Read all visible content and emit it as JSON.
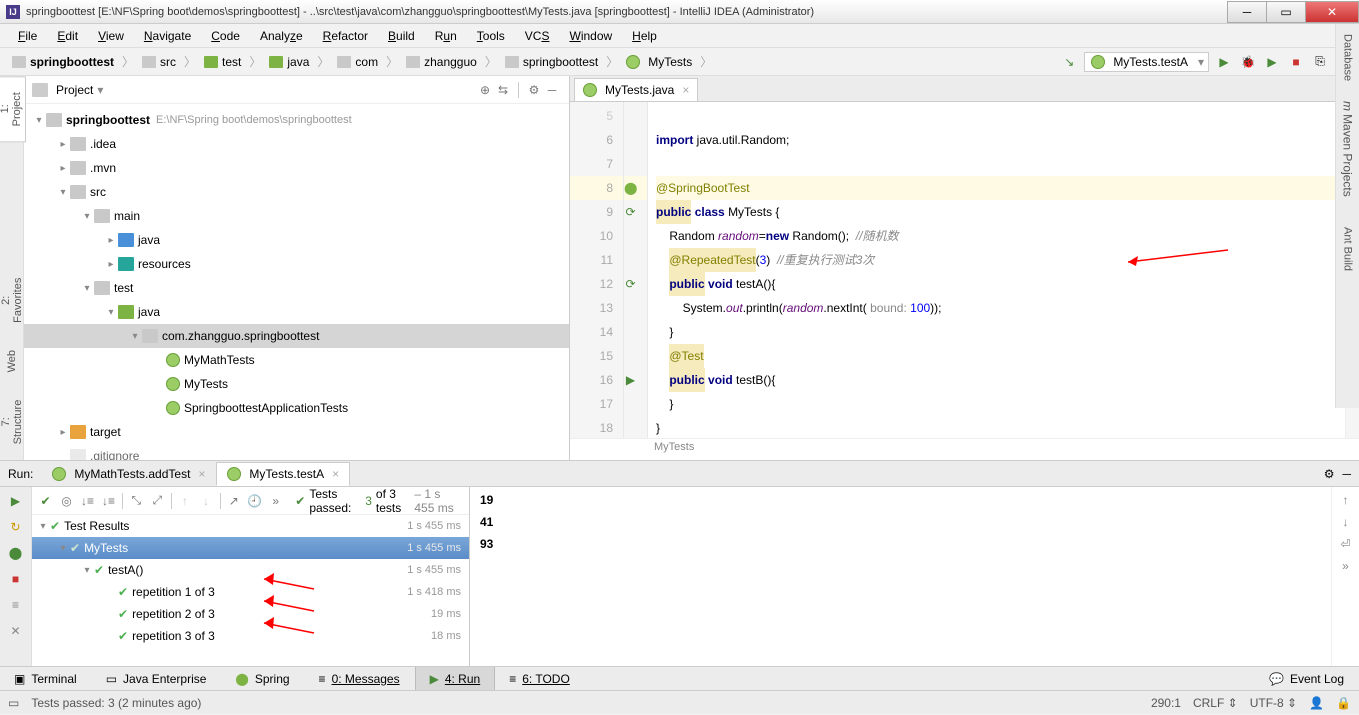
{
  "titlebar": {
    "text": "springboottest [E:\\NF\\Spring boot\\demos\\springboottest] - ..\\src\\test\\java\\com\\zhangguo\\springboottest\\MyTests.java [springboottest] - IntelliJ IDEA (Administrator)"
  },
  "menu": [
    "File",
    "Edit",
    "View",
    "Navigate",
    "Code",
    "Analyze",
    "Refactor",
    "Build",
    "Run",
    "Tools",
    "VCS",
    "Window",
    "Help"
  ],
  "breadcrumbs": [
    "springboottest",
    "src",
    "test",
    "java",
    "com",
    "zhangguo",
    "springboottest",
    "MyTests"
  ],
  "run_config": "MyTests.testA",
  "project_panel_title": "Project",
  "tree": {
    "root": "springboottest",
    "root_path": "E:\\NF\\Spring boot\\demos\\springboottest",
    "idea": ".idea",
    "mvn": ".mvn",
    "src": "src",
    "main": "main",
    "java_m": "java",
    "res": "resources",
    "test": "test",
    "java_t": "java",
    "pkg": "com.zhangguo.springboottest",
    "c1": "MyMathTests",
    "c2": "MyTests",
    "c3": "SpringboottestApplicationTests",
    "target": "target",
    "gitignore": ".gitignore"
  },
  "editor_tab": "MyTests.java",
  "code": {
    "l6": "import java.util.Random;",
    "l8_ann": "@SpringBootTest",
    "l9_a": "public",
    "l9_b": "class",
    "l9_c": "MyTests {",
    "l10_a": "Random ",
    "l10_b": "random",
    "l10_c": "=",
    "l10_d": "new",
    "l10_e": " Random();  ",
    "l10_f": "//随机数",
    "l11_a": "@RepeatedTest",
    "l11_b": "(",
    "l11_c": "3",
    "l11_d": ")  ",
    "l11_e": "//重复执行测试3次",
    "l12_a": "public",
    "l12_b": " ",
    "l12_c": "void",
    "l12_d": " testA(){",
    "l13_a": "System.",
    "l13_b": "out",
    "l13_c": ".println(",
    "l13_d": "random",
    "l13_e": ".nextInt( ",
    "l13_f": "bound: ",
    "l13_g": "100",
    "l13_h": "));",
    "l14": "}",
    "l15_a": "@Test",
    "l16_a": "public",
    "l16_b": " ",
    "l16_c": "void",
    "l16_d": " testB(){",
    "l17": "}",
    "l18": "}",
    "crumb": "MyTests"
  },
  "run": {
    "label": "Run:",
    "tab1": "MyMathTests.addTest",
    "tab2": "MyTests.testA",
    "summary_a": "Tests passed:",
    "summary_b": "3",
    "summary_c": "of 3 tests",
    "summary_d": "– 1 s 455 ms",
    "tree": {
      "root": "Test Results",
      "root_t": "1 s 455 ms",
      "n1": "MyTests",
      "n1_t": "1 s 455 ms",
      "n2": "testA()",
      "n2_t": "1 s 455 ms",
      "r1": "repetition 1 of 3",
      "r1_t": "1 s 418 ms",
      "r2": "repetition 2 of 3",
      "r2_t": "19 ms",
      "r3": "repetition 3 of 3",
      "r3_t": "18 ms"
    },
    "out": [
      "19",
      "41",
      "93"
    ]
  },
  "segbar": {
    "terminal": "Terminal",
    "jee": "Java Enterprise",
    "spring": "Spring",
    "messages": "0: Messages",
    "run": "4: Run",
    "todo": "6: TODO",
    "eventlog": "Event Log"
  },
  "status": {
    "msg": "Tests passed: 3 (2 minutes ago)",
    "pos": "290:1",
    "crlf": "CRLF",
    "enc": "UTF-8"
  },
  "sidetabs": {
    "project": "1: Project",
    "favorites": "2: Favorites",
    "structure": "7: Structure",
    "web": "Web",
    "database": "Database",
    "maven": "Maven Projects",
    "ant": "Ant Build"
  }
}
